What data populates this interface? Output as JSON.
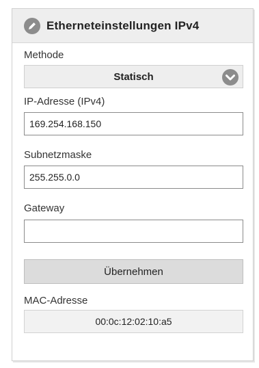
{
  "header": {
    "title": "Etherneteinstellungen IPv4",
    "icon": "pencil-icon"
  },
  "method": {
    "label": "Methode",
    "value": "Statisch",
    "icon": "chevron-down-icon"
  },
  "ip": {
    "label": "IP-Adresse (IPv4)",
    "value": "169.254.168.150"
  },
  "subnet": {
    "label": "Subnetzmaske",
    "value": "255.255.0.0"
  },
  "gateway": {
    "label": "Gateway",
    "value": ""
  },
  "apply_button": {
    "label": "Übernehmen"
  },
  "mac": {
    "label": "MAC-Adresse",
    "value": "00:0c:12:02:10:a5"
  },
  "colors": {
    "icon_fill": "#8c8c8c",
    "header_bg": "#eeeeee",
    "button_bg": "#dcdcdc"
  }
}
